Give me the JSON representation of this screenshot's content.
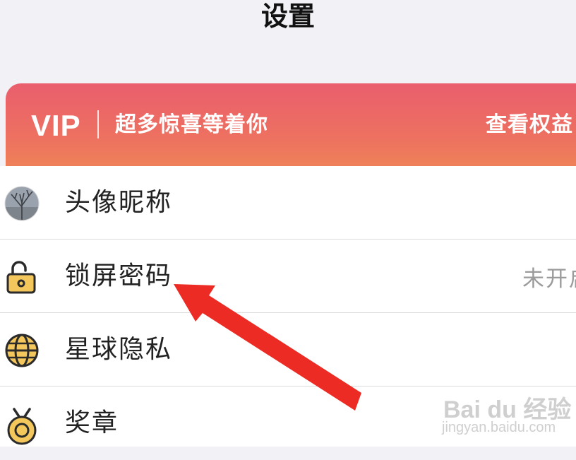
{
  "header": {
    "title": "设置"
  },
  "vip": {
    "logo": "VIP",
    "slogan": "超多惊喜等着你",
    "benefits_label": "查看权益"
  },
  "settings": {
    "items": [
      {
        "label": "头像昵称",
        "icon": "avatar-icon"
      },
      {
        "label": "锁屏密码",
        "icon": "unlocked-padlock-icon",
        "value": "未开启"
      },
      {
        "label": "星球隐私",
        "icon": "globe-icon"
      },
      {
        "label": "奖章",
        "icon": "medal-icon"
      }
    ]
  },
  "watermark": {
    "logo": "Bai du 经验",
    "url": "jingyan.baidu.com"
  },
  "colors": {
    "vip_gradient_top": "#ea5e6d",
    "vip_gradient_bottom": "#ef8a55",
    "arrow": "#ec2b24",
    "icon_yellow": "#f4c75c"
  }
}
